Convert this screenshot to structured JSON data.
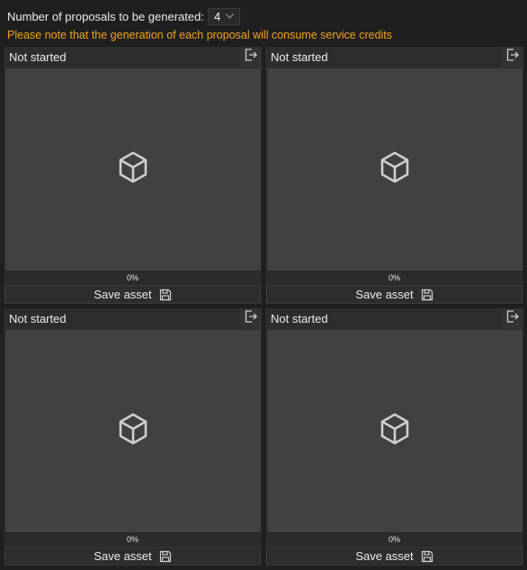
{
  "settings": {
    "count_label": "Number of proposals to be generated:",
    "count_value": "4",
    "warning": "Please note that the generation of each proposal will consume service credits"
  },
  "colors": {
    "warning": "#f0a21f",
    "background": "#1f1f1f",
    "preview": "#414141"
  },
  "proposals": [
    {
      "status": "Not started",
      "progress_text": "0%",
      "progress": 0,
      "save_label": "Save asset",
      "preview_icon": "cube-icon",
      "export_icon": "export-icon",
      "save_icon": "save-icon"
    },
    {
      "status": "Not started",
      "progress_text": "0%",
      "progress": 0,
      "save_label": "Save asset",
      "preview_icon": "cube-icon",
      "export_icon": "export-icon",
      "save_icon": "save-icon"
    },
    {
      "status": "Not started",
      "progress_text": "0%",
      "progress": 0,
      "save_label": "Save asset",
      "preview_icon": "cube-icon",
      "export_icon": "export-icon",
      "save_icon": "save-icon"
    },
    {
      "status": "Not started",
      "progress_text": "0%",
      "progress": 0,
      "save_label": "Save asset",
      "preview_icon": "cube-icon",
      "export_icon": "export-icon",
      "save_icon": "save-icon"
    }
  ]
}
